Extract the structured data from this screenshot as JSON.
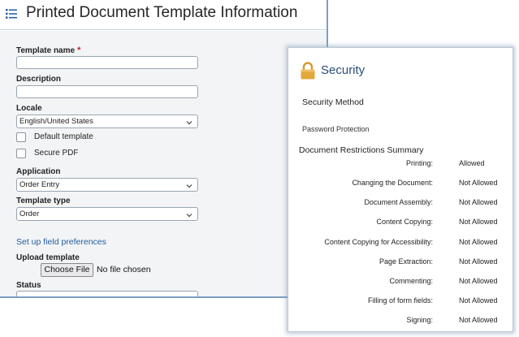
{
  "form": {
    "title": "Printed Document Template Information",
    "template_name_label": "Template name",
    "required_mark": "*",
    "description_label": "Description",
    "locale_label": "Locale",
    "locale_value": "English/United States",
    "default_template_label": "Default template",
    "secure_pdf_label": "Secure PDF",
    "application_label": "Application",
    "application_value": "Order Entry",
    "template_type_label": "Template type",
    "template_type_value": "Order",
    "field_prefs_link": "Set up field preferences",
    "upload_label": "Upload template",
    "choose_file_label": "Choose File",
    "no_file_text": "No file chosen",
    "status_label": "Status"
  },
  "security": {
    "title": "Security",
    "method_label": "Security Method",
    "method_value": "Password Protection",
    "summary_label": "Document Restrictions Summary",
    "restrictions": [
      {
        "name": "Printing:",
        "value": "Allowed"
      },
      {
        "name": "Changing the Document:",
        "value": "Not Allowed"
      },
      {
        "name": "Document Assembly:",
        "value": "Not Allowed"
      },
      {
        "name": "Content Copying:",
        "value": "Not Allowed"
      },
      {
        "name": "Content Copying for Accessibility:",
        "value": "Not Allowed"
      },
      {
        "name": "Page Extraction:",
        "value": "Not Allowed"
      },
      {
        "name": "Commenting:",
        "value": "Not Allowed"
      },
      {
        "name": "Filling of form fields:",
        "value": "Not Allowed"
      },
      {
        "name": "Signing:",
        "value": "Not Allowed"
      }
    ]
  },
  "colors": {
    "accent_blue": "#2a4d7a",
    "link_blue": "#1f5c9c",
    "required_red": "#c8252c",
    "lock_gold": "#e2a83c"
  },
  "icons": {
    "header": "list-icon",
    "security": "lock-icon",
    "select": "chevron-down-icon"
  }
}
